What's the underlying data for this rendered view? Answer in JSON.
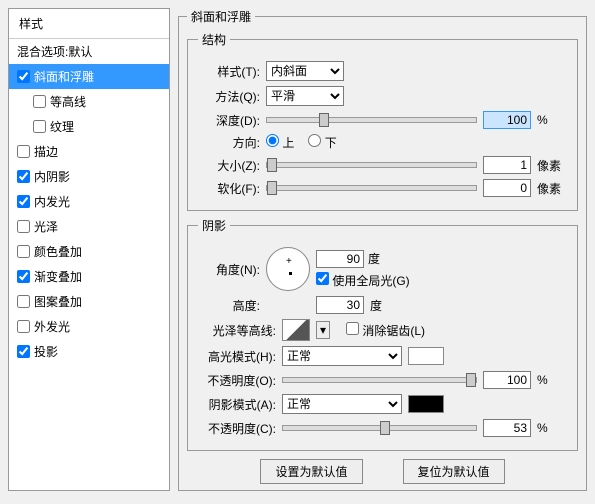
{
  "sidebar": {
    "header": "样式",
    "items": [
      {
        "label": "混合选项:默认",
        "checked": null
      },
      {
        "label": "斜面和浮雕",
        "checked": true,
        "selected": true
      },
      {
        "label": "等高线",
        "checked": false,
        "indent": true
      },
      {
        "label": "纹理",
        "checked": false,
        "indent": true
      },
      {
        "label": "描边",
        "checked": false
      },
      {
        "label": "内阴影",
        "checked": true
      },
      {
        "label": "内发光",
        "checked": true
      },
      {
        "label": "光泽",
        "checked": false
      },
      {
        "label": "颜色叠加",
        "checked": false
      },
      {
        "label": "渐变叠加",
        "checked": true
      },
      {
        "label": "图案叠加",
        "checked": false
      },
      {
        "label": "外发光",
        "checked": false
      },
      {
        "label": "投影",
        "checked": true
      }
    ]
  },
  "panel_title": "斜面和浮雕",
  "structure": {
    "legend": "结构",
    "style_label": "样式(T):",
    "style_value": "内斜面",
    "method_label": "方法(Q):",
    "method_value": "平滑",
    "depth_label": "深度(D):",
    "depth_value": "100",
    "depth_unit": "%",
    "direction_label": "方向:",
    "up": "上",
    "down": "下",
    "size_label": "大小(Z):",
    "size_value": "1",
    "size_unit": "像素",
    "soften_label": "软化(F):",
    "soften_value": "0",
    "soften_unit": "像素"
  },
  "shading": {
    "legend": "阴影",
    "angle_label": "角度(N):",
    "angle_value": "90",
    "angle_unit": "度",
    "global_label": "使用全局光(G)",
    "altitude_label": "高度:",
    "altitude_value": "30",
    "altitude_unit": "度",
    "contour_label": "光泽等高线:",
    "antialias_label": "消除锯齿(L)",
    "highlight_mode_label": "高光模式(H):",
    "highlight_mode_value": "正常",
    "highlight_opacity_label": "不透明度(O):",
    "highlight_opacity_value": "100",
    "highlight_opacity_unit": "%",
    "shadow_mode_label": "阴影模式(A):",
    "shadow_mode_value": "正常",
    "shadow_opacity_label": "不透明度(C):",
    "shadow_opacity_value": "53",
    "shadow_opacity_unit": "%"
  },
  "buttons": {
    "default": "设置为默认值",
    "reset": "复位为默认值"
  }
}
